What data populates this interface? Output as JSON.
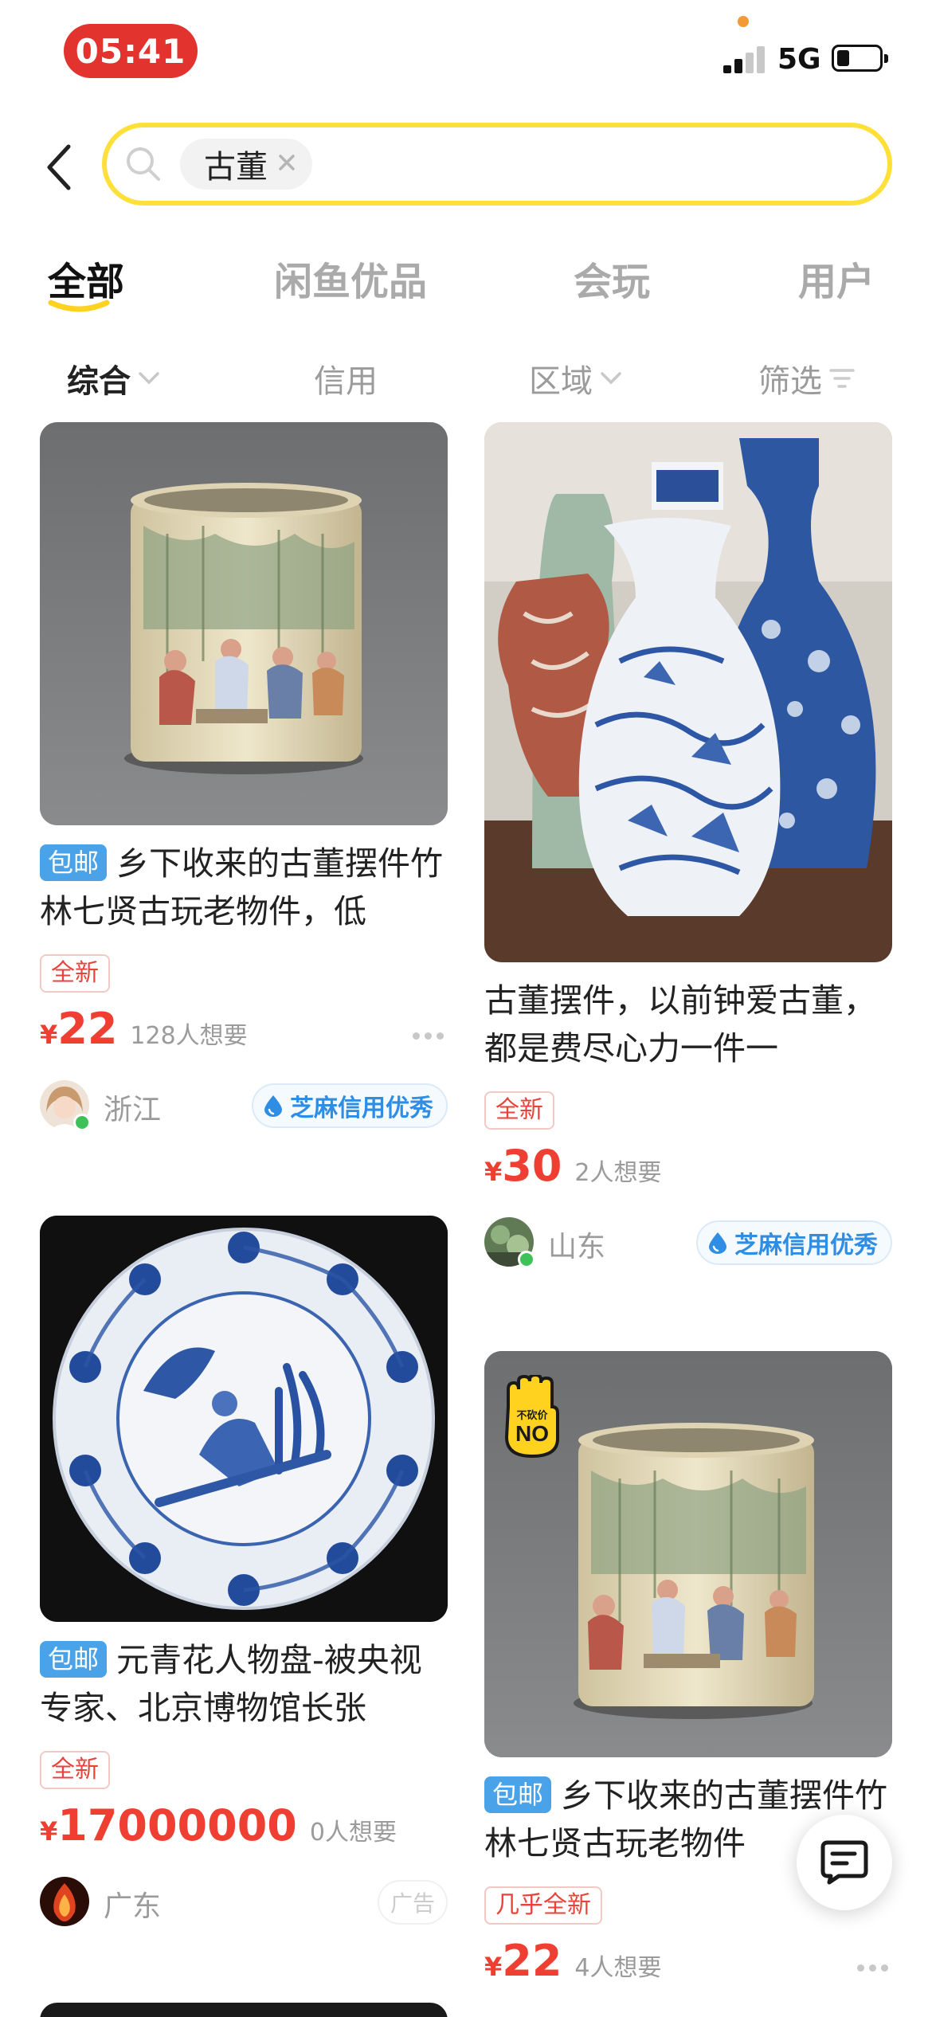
{
  "status_bar": {
    "time": "05:41",
    "network": "5G",
    "battery_level": 0.3
  },
  "search": {
    "keyword": "古董"
  },
  "tabs": [
    {
      "label": "全部",
      "active": true
    },
    {
      "label": "闲鱼优品",
      "active": false
    },
    {
      "label": "会玩",
      "active": false
    },
    {
      "label": "用户",
      "active": false
    }
  ],
  "filters": [
    {
      "label": "综合",
      "active": true,
      "icon": "chevron-down-icon"
    },
    {
      "label": "信用",
      "active": false
    },
    {
      "label": "区域",
      "active": false,
      "icon": "chevron-down-icon"
    },
    {
      "label": "筛选",
      "active": false,
      "icon": "filter-icon"
    }
  ],
  "colors": {
    "accent_yellow": "#ffe03a",
    "price_red": "#ef3f33",
    "free_ship_blue": "#4aa3e8",
    "credit_blue": "#2f8de4"
  },
  "products": [
    {
      "free_shipping": "包邮",
      "title": "乡下收来的古董摆件竹林七贤古玩老物件，低",
      "condition": "全新",
      "currency": "¥",
      "price": "22",
      "wants": "128人想要",
      "region": "浙江",
      "credit": "芝麻信用优秀",
      "image": "porcelain-brush-pot"
    },
    {
      "title": "古董摆件，以前钟爱古董，都是费尽心力一件一",
      "condition": "全新",
      "currency": "¥",
      "price": "30",
      "wants": "2人想要",
      "region": "山东",
      "credit": "芝麻信用优秀",
      "image": "blue-white-vases"
    },
    {
      "free_shipping": "包邮",
      "title": "元青花人物盘-被央视专家、北京博物馆长张",
      "condition": "全新",
      "currency": "¥",
      "price": "17000000",
      "wants": "0人想要",
      "region": "广东",
      "ad": "广告",
      "image": "blue-white-plate"
    },
    {
      "badge_small": "不砍价",
      "badge_big": "NO",
      "free_shipping": "包邮",
      "title": "乡下收来的古董摆件竹林七贤古玩老物件",
      "condition": "几乎全新",
      "currency": "¥",
      "price": "22",
      "wants": "4人想要",
      "image": "porcelain-brush-pot"
    }
  ]
}
